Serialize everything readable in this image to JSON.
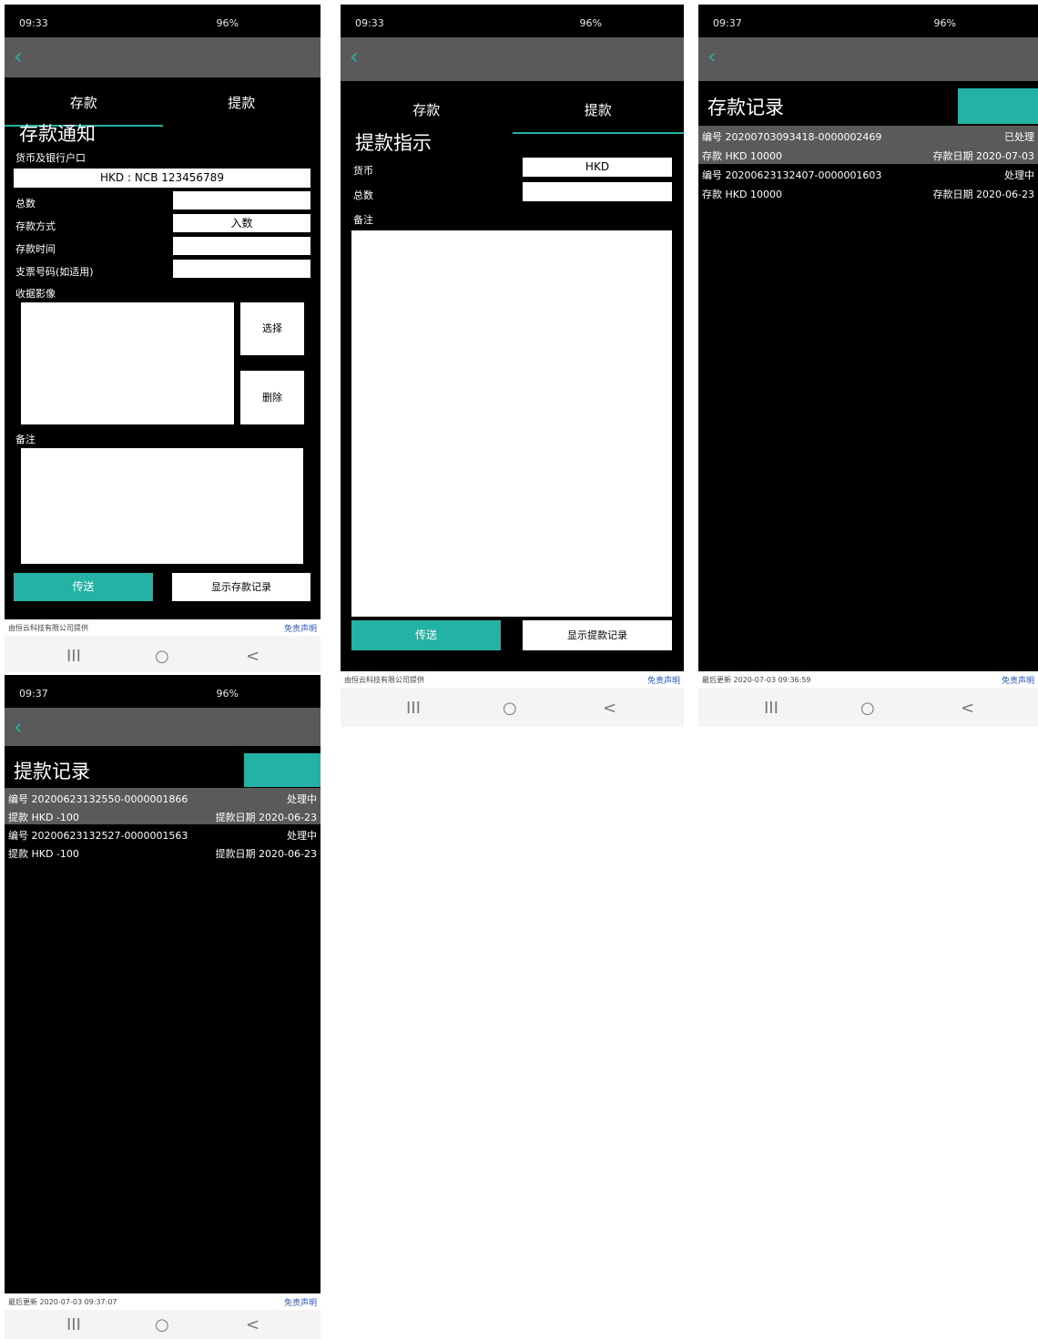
{
  "status_bar": {
    "deposit_form_time": "09:33",
    "withdraw_form_time": "09:33",
    "deposit_records_time": "09:37",
    "withdraw_records_time": "09:37",
    "right": "96%"
  },
  "nav": {
    "back_glyph": "‹",
    "recent": "III",
    "home": "○",
    "back": "<"
  },
  "tabs": {
    "deposit": "存款",
    "withdraw": "提款"
  },
  "deposit_form": {
    "title": "存款通知",
    "account_label": "货币及银行户口",
    "account_value": "HKD : NCB 123456789",
    "amount_label": "总数",
    "method_label": "存款方式",
    "method_value": "入数",
    "time_label": "存款时间",
    "cheque_label": "支票号码(如适用)",
    "receipt_label": "收据影像",
    "select_button": "选择",
    "delete_button": "删除",
    "remarks_label": "备注",
    "send_button": "传送",
    "show_records_button": "显示存款记录",
    "footer_left": "由恒云科技有限公司提供",
    "footer_right": "免责声明"
  },
  "withdraw_form": {
    "title": "提款指示",
    "currency_label": "货币",
    "currency_value": "HKD",
    "amount_label": "总数",
    "remarks_label": "备注",
    "send_button": "传送",
    "show_records_button": "显示提款记录",
    "footer_left": "由恒云科技有限公司提供",
    "footer_right": "免责声明"
  },
  "deposit_records": {
    "title": "存款记录",
    "records": [
      {
        "id": "编号 20200703093418-0000002469",
        "status": "已处理",
        "amount": "存款 HKD 10000",
        "date": "存款日期 2020-07-03"
      },
      {
        "id": "编号 20200623132407-0000001603",
        "status": "处理中",
        "amount": "存款 HKD 10000",
        "date": "存款日期 2020-06-23"
      }
    ],
    "footer_left": "最后更新 2020-07-03 09:36:59",
    "footer_right": "免责声明"
  },
  "withdraw_records": {
    "title": "提款记录",
    "records": [
      {
        "id": "编号 20200623132550-0000001866",
        "status": "处理中",
        "amount": "提款 HKD -100",
        "date": "提款日期 2020-06-23"
      },
      {
        "id": "编号 20200623132527-0000001563",
        "status": "处理中",
        "amount": "提款 HKD -100",
        "date": "提款日期 2020-06-23"
      }
    ],
    "footer_left": "最后更新 2020-07-03 09:37:07",
    "footer_right": "免责声明"
  },
  "colors": {
    "accent": "#24b2a5",
    "appbar": "#5a5a5a",
    "background": "#000000"
  }
}
